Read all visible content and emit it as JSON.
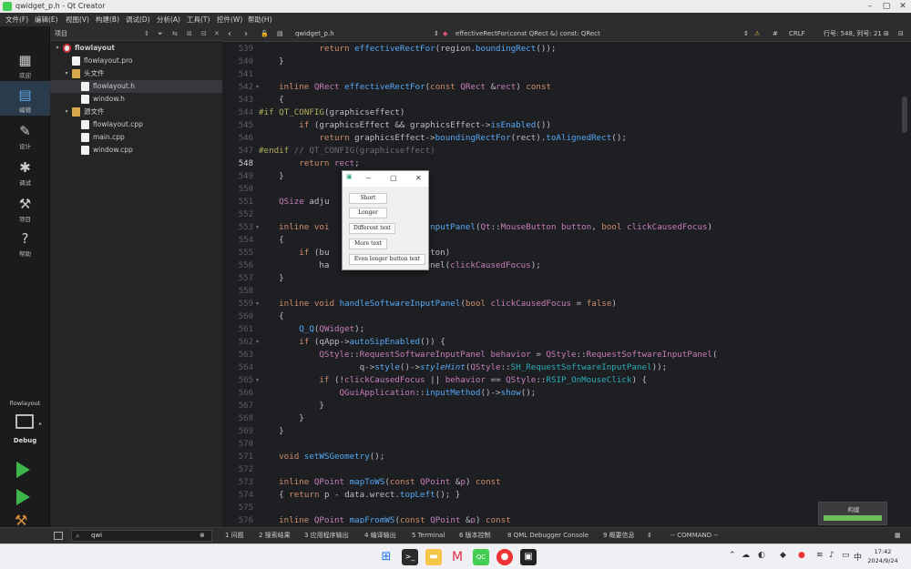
{
  "window": {
    "title": "qwidget_p.h - Qt Creator"
  },
  "menu": [
    "文件(F)",
    "编辑(E)",
    "视图(V)",
    "构建(B)",
    "调试(D)",
    "分析(A)",
    "工具(T)",
    "控件(W)",
    "帮助(H)"
  ],
  "modes": [
    "欢迎",
    "编辑",
    "设计",
    "调试",
    "项目",
    "帮助"
  ],
  "kit": {
    "project": "flowlayout",
    "config": "Debug"
  },
  "sidebar": {
    "header": "项目",
    "items": [
      {
        "label": "flowlayout",
        "level": 0,
        "kind": "project"
      },
      {
        "label": "flowlayout.pro",
        "level": 1,
        "kind": "file"
      },
      {
        "label": "头文件",
        "level": 1,
        "kind": "folder"
      },
      {
        "label": "flowlayout.h",
        "level": 2,
        "kind": "file",
        "selected": true
      },
      {
        "label": "window.h",
        "level": 2,
        "kind": "file"
      },
      {
        "label": "源文件",
        "level": 1,
        "kind": "folder"
      },
      {
        "label": "flowlayout.cpp",
        "level": 2,
        "kind": "file"
      },
      {
        "label": "main.cpp",
        "level": 2,
        "kind": "file"
      },
      {
        "label": "window.cpp",
        "level": 2,
        "kind": "file"
      }
    ]
  },
  "editor": {
    "file": "qwidget_p.h",
    "symbol": "effectiveRectFor(const QRect &) const: QRect",
    "encoding": "#",
    "line_ending": "CRLF",
    "position": "行号: 548, 列号: 21",
    "current_line": 548,
    "lines": [
      {
        "n": 539,
        "html": "            <span class='kw'>return</span> <span class='fn'>effectiveRectFor</span>(region.<span class='fn'>boundingRect</span>());"
      },
      {
        "n": 540,
        "html": "    }"
      },
      {
        "n": 541,
        "html": ""
      },
      {
        "n": 542,
        "html": "    <span class='kw'>inline</span> <span class='ty'>QRect</span> <span class='fn'>effectiveRectFor</span>(<span class='kw'>const</span> <span class='ty'>QRect</span> &amp;<span class='pa'>rect</span>) <span class='kw'>const</span>",
        "fold": true
      },
      {
        "n": 543,
        "html": "    {"
      },
      {
        "n": 544,
        "html": "<span class='pp'>#if</span> <span class='pp'>QT_CONFIG</span>(graphicseffect)"
      },
      {
        "n": 545,
        "html": "        <span class='kw'>if</span> (graphicsEffect &amp;&amp; graphicsEffect-&gt;<span class='fn'>isEnabled</span>())"
      },
      {
        "n": 546,
        "html": "            <span class='kw'>return</span> graphicsEffect-&gt;<span class='fn'>boundingRectFor</span>(rect).<span class='fn'>toAlignedRect</span>();"
      },
      {
        "n": 547,
        "html": "<span class='pp'>#endif</span> <span class='cm'>// QT_CONFIG(graphicseffect)</span>"
      },
      {
        "n": 548,
        "html": "        <span class='kw'>return</span> <span class='pa'>rect</span>;"
      },
      {
        "n": 549,
        "html": "    }"
      },
      {
        "n": 550,
        "html": ""
      },
      {
        "n": 551,
        "html": "    <span class='ty'>QSize</span> adju"
      },
      {
        "n": 552,
        "html": ""
      },
      {
        "n": 553,
        "html": "    <span class='kw'>inline</span> <span class='kw'>voi</span>                    <span class='fn'>nputPanel</span>(<span class='ty'>Qt</span>::<span class='ty'>MouseButton</span> <span class='pa'>button</span>, <span class='kw'>bool</span> <span class='pa'>clickCausedFocus</span>)",
        "fold": true
      },
      {
        "n": 554,
        "html": "    {"
      },
      {
        "n": 555,
        "html": "        <span class='kw'>if</span> (bu                   tton)"
      },
      {
        "n": 556,
        "html": "            ha                   anel(<span class='pa'>clickCausedFocus</span>);"
      },
      {
        "n": 557,
        "html": "    }"
      },
      {
        "n": 558,
        "html": ""
      },
      {
        "n": 559,
        "html": "    <span class='kw'>inline</span> <span class='kw'>void</span> <span class='fn'>handleSoftwareInputPanel</span>(<span class='kw'>bool</span> <span class='pa'>clickCausedFocus</span> = <span class='kw'>false</span>)",
        "fold": true
      },
      {
        "n": 560,
        "html": "    {"
      },
      {
        "n": 561,
        "html": "        <span class='fn'>Q_Q</span>(<span class='ty'>QWidget</span>);"
      },
      {
        "n": 562,
        "html": "        <span class='kw'>if</span> (qApp-&gt;<span class='fn'>autoSipEnabled</span>()) {",
        "fold": true
      },
      {
        "n": 563,
        "html": "            <span class='ty'>QStyle</span>::<span class='ty'>RequestSoftwareInputPanel</span> <span class='pa'>behavior</span> = <span class='ty'>QStyle</span>::<span class='ty'>RequestSoftwareInputPanel</span>("
      },
      {
        "n": 564,
        "html": "                    q-&gt;<span class='fn'>style</span>()-&gt;<span class='fn'><i>styleHint</i></span>(<span class='ty'>QStyle</span>::<span class='nm'>SH_RequestSoftwareInputPanel</span>));"
      },
      {
        "n": 565,
        "html": "            <span class='kw'>if</span> (!<span class='pa'>clickCausedFocus</span> || <span class='pa'>behavior</span> == <span class='ty'>QStyle</span>::<span class='nm'>RSIP_OnMouseClick</span>) {",
        "fold": true
      },
      {
        "n": 566,
        "html": "                <span class='ty'>QGuiApplication</span>::<span class='fn'>inputMethod</span>()-&gt;<span class='fn'>show</span>();"
      },
      {
        "n": 567,
        "html": "            }"
      },
      {
        "n": 568,
        "html": "        }"
      },
      {
        "n": 569,
        "html": "    }"
      },
      {
        "n": 570,
        "html": ""
      },
      {
        "n": 571,
        "html": "    <span class='kw'>void</span> <span class='fn'>setWSGeometry</span>();"
      },
      {
        "n": 572,
        "html": ""
      },
      {
        "n": 573,
        "html": "    <span class='kw'>inline</span> <span class='ty'>QPoint</span> <span class='fn'>mapToWS</span>(<span class='kw'>const</span> <span class='ty'>QPoint</span> &amp;<span class='pa'>p</span>) <span class='kw'>const</span>"
      },
      {
        "n": 574,
        "html": "    { <span class='kw'>return</span> p - data.wrect.<span class='fn'>topLeft</span>(); }"
      },
      {
        "n": 575,
        "html": ""
      },
      {
        "n": 576,
        "html": "    <span class='kw'>inline</span> <span class='ty'>QPoint</span> <span class='fn'>mapFromWS</span>(<span class='kw'>const</span> <span class='ty'>QPoint</span> &amp;<span class='pa'>p</span>) <span class='kw'>const</span>"
      }
    ]
  },
  "popup": {
    "buttons": [
      "Short",
      "Longer",
      "Different text",
      "More text",
      "Even longer button text"
    ]
  },
  "build": {
    "label": "构建",
    "progress": 1.0
  },
  "locator": {
    "value": "qwi"
  },
  "output_tabs": [
    "1 问题",
    "2 搜索结果",
    "3 应用程序输出",
    "4 编译输出",
    "5 Terminal",
    "6 版本控制",
    "8 QML Debugger Console",
    "9 概要信息"
  ],
  "status": {
    "mode": "-- COMMAND --"
  },
  "taskbar": {
    "time": "17:42",
    "date": "2024/9/24",
    "lang": "中"
  },
  "colors": {
    "accent": "#41cd52",
    "editor_bg": "#1e1f22",
    "keyword": "#cf8e6d",
    "type": "#c77dbb",
    "function": "#56a8f5"
  }
}
